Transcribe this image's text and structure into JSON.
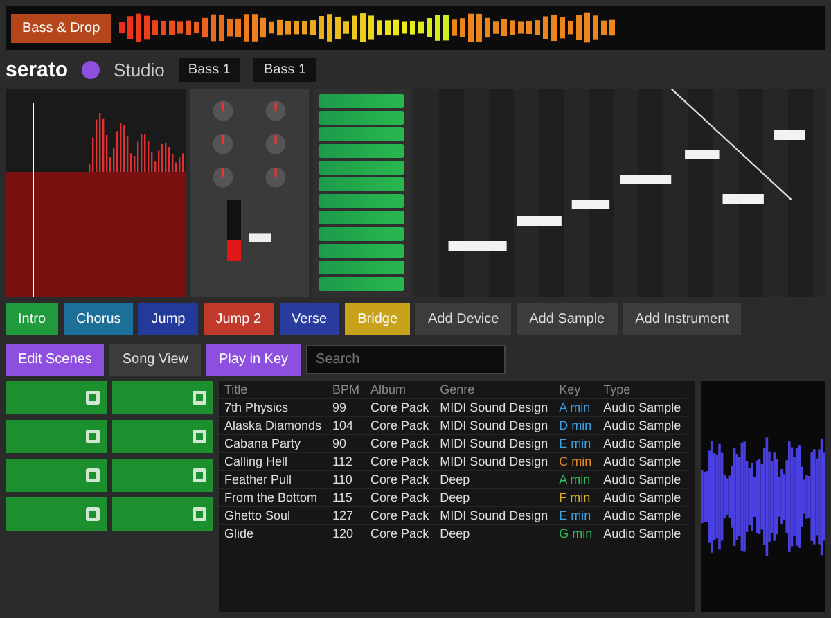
{
  "overview": {
    "clip_label": "Bass & Drop"
  },
  "header": {
    "logo": "serato",
    "product": "Studio",
    "deck_label": "Bass 1",
    "track_label": "Bass 1"
  },
  "fader": {
    "level": 0.35
  },
  "scenes": [
    {
      "label": "Intro",
      "color": "#1f9a3c"
    },
    {
      "label": "Chorus",
      "color": "#1b6f98"
    },
    {
      "label": "Jump",
      "color": "#233a9a"
    },
    {
      "label": "Jump 2",
      "color": "#c0392b"
    },
    {
      "label": "Verse",
      "color": "#2a3d9e"
    },
    {
      "label": "Bridge",
      "color": "#c9a21c"
    }
  ],
  "actions": [
    "Add Device",
    "Add Sample",
    "Add Instrument"
  ],
  "edit_button": "Edit Scenes",
  "view_button": "Song View",
  "play_in_key": "Play in Key",
  "search": {
    "placeholder": "Search"
  },
  "library": {
    "columns": [
      "Title",
      "BPM",
      "Album",
      "Genre",
      "Key",
      "Type"
    ],
    "rows": [
      {
        "cells": [
          "7th Physics",
          "99",
          "Core Pack",
          "MIDI Sound Design",
          "A min",
          "Audio Sample"
        ],
        "color": "#3fa0e0"
      },
      {
        "cells": [
          "Alaska Diamonds",
          "104",
          "Core Pack",
          "MIDI Sound Design",
          "D min",
          "Audio Sample"
        ],
        "color": "#3fa0e1"
      },
      {
        "cells": [
          "Cabana Party",
          "90",
          "Core Pack",
          "MIDI Sound Design",
          "E min",
          "Audio Sample"
        ],
        "color": "#3fa0e2"
      },
      {
        "cells": [
          "Calling Hell",
          "112",
          "Core Pack",
          "MIDI Sound Design",
          "C min",
          "Audio Sample"
        ],
        "color": "#e08a2a"
      },
      {
        "cells": [
          "Feather Pull",
          "110",
          "Core Pack",
          "Deep",
          "A min",
          "Audio Sample"
        ],
        "color": "#2fbf5a"
      },
      {
        "cells": [
          "From the Bottom",
          "115",
          "Core Pack",
          "Deep",
          "F min",
          "Audio Sample"
        ],
        "color": "#e0b02a"
      },
      {
        "cells": [
          "Ghetto Soul",
          "127",
          "Core Pack",
          "MIDI Sound Design",
          "E min",
          "Audio Sample"
        ],
        "color": "#3fa0e3"
      },
      {
        "cells": [
          "Glide",
          "120",
          "Core Pack",
          "Deep",
          "G min",
          "Audio Sample"
        ],
        "color": "#2fbf5b"
      }
    ]
  }
}
